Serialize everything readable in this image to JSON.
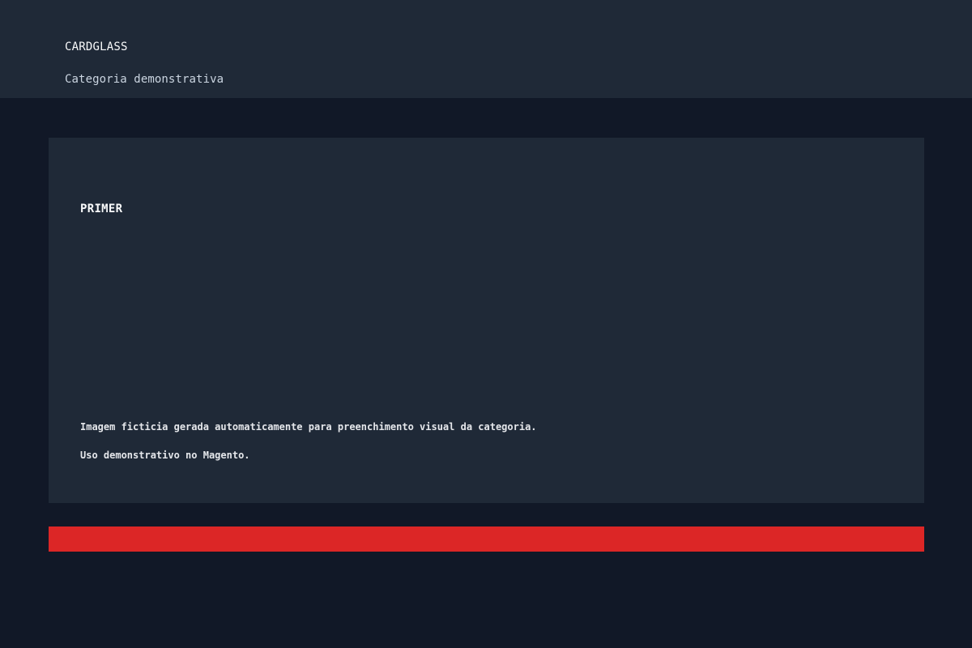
{
  "header": {
    "brand": "CARDGLASS",
    "subtitle": "Categoria demonstrativa"
  },
  "card": {
    "title": "PRIMER",
    "lines": [
      "Imagem ficticia gerada automaticamente para preenchimento visual da categoria.",
      "Uso demonstrativo no Magento."
    ]
  },
  "colors": {
    "page_background": "#111827",
    "panel_background": "#1f2937",
    "accent": "#dc2626"
  }
}
